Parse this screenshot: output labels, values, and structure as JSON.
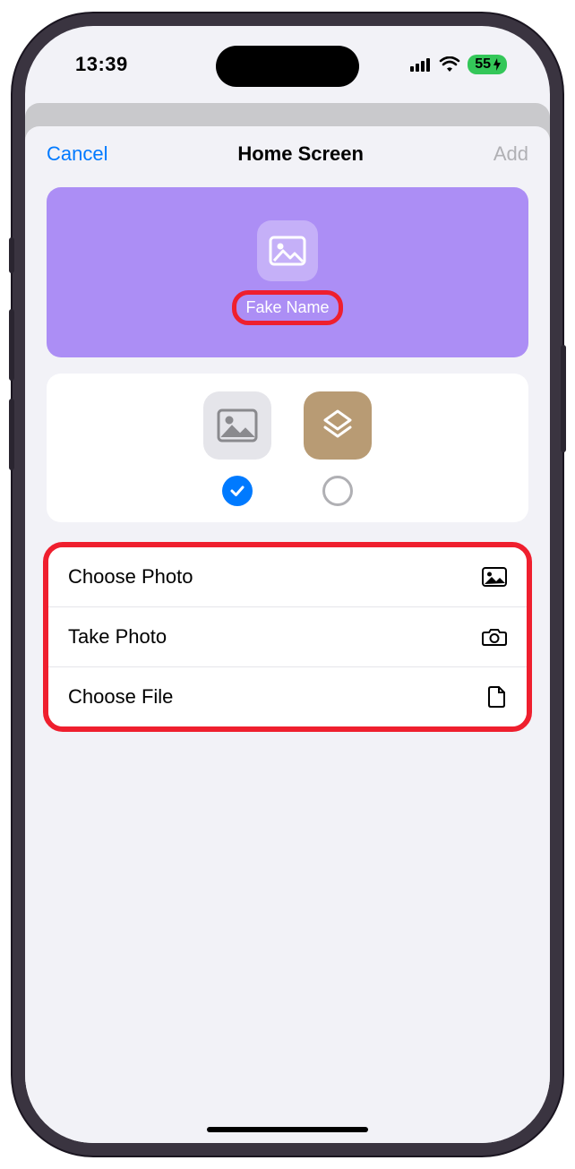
{
  "status": {
    "time": "13:39",
    "battery": "55"
  },
  "sheet": {
    "cancel": "Cancel",
    "title": "Home Screen",
    "add": "Add"
  },
  "preview": {
    "name": "Fake Name"
  },
  "actions": {
    "choose_photo": "Choose Photo",
    "take_photo": "Take Photo",
    "choose_file": "Choose File"
  }
}
